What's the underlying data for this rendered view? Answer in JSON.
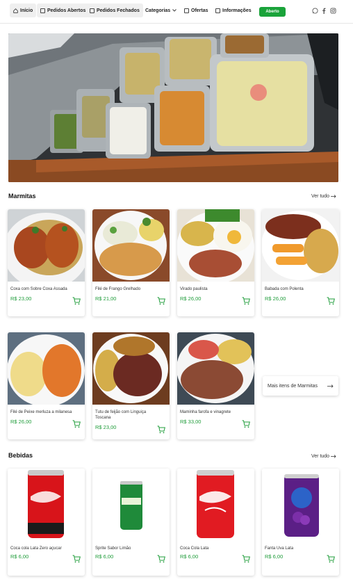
{
  "nav": {
    "inicio": "Início",
    "pedidos_abertos": "Pedidos Abertos",
    "pedidos_fechados": "Pedidos Fechados",
    "categorias": "Categorias",
    "ofertas": "Ofertas",
    "informacoes": "Informações",
    "status": "Aberto"
  },
  "colors": {
    "accent": "#1aa33a",
    "price": "#1f9c3a"
  },
  "sections": {
    "marmitas": {
      "title": "Marmitas",
      "see_all": "Ver tudo"
    },
    "bebidas": {
      "title": "Bebidas",
      "see_all": "Ver tudo"
    }
  },
  "marmitas": [
    {
      "name": "Coxa com Sobre Coxa Assada",
      "price": "R$ 23,00"
    },
    {
      "name": "Filé de Frango Grelhado",
      "price": "R$ 21,00"
    },
    {
      "name": "Virado paulista",
      "price": "R$ 26,00"
    },
    {
      "name": "Babada com Polenta",
      "price": "R$ 26,00"
    },
    {
      "name": "Filé de Peixe merluza a milanesa",
      "price": "R$ 26,00"
    },
    {
      "name": "Tutu de feijão com Linguiça Toscana",
      "price": "R$ 23,00"
    },
    {
      "name": "Maminha farofa e vinagrete",
      "price": "R$ 33,00"
    }
  ],
  "more_marmitas": "Mais itens de Marmitas",
  "bebidas": [
    {
      "name": "Coca cola Lata Zero açucar",
      "price": "R$ 6,00"
    },
    {
      "name": "Sprite Sabor Limão",
      "price": "R$ 6,00"
    },
    {
      "name": "Coca Cola Lata",
      "price": "R$ 6,00"
    },
    {
      "name": "Fanta Uva Lata",
      "price": "R$ 6,00"
    }
  ]
}
